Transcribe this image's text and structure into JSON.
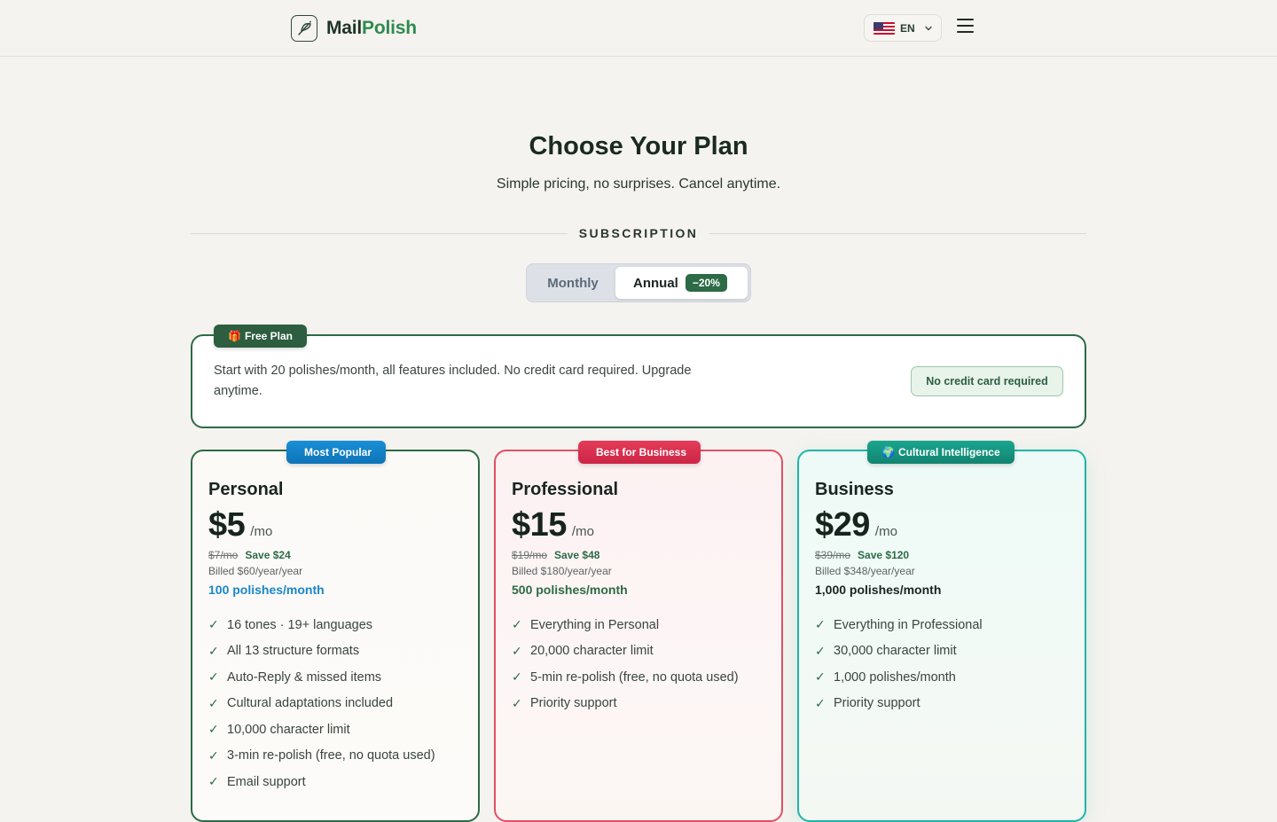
{
  "header": {
    "brand_part1": "Mail",
    "brand_part2": "Polish",
    "lang_code": "EN",
    "icons": {
      "logo": "quill-pen-icon",
      "flag": "us-flag-icon",
      "chevron": "chevron-down-icon",
      "menu": "hamburger-menu-icon"
    }
  },
  "hero": {
    "title": "Choose Your Plan",
    "subtitle": "Simple pricing, no surprises. Cancel anytime."
  },
  "section": {
    "label": "SUBSCRIPTION"
  },
  "billing_toggle": {
    "monthly": "Monthly",
    "annual": "Annual",
    "discount": "−20%",
    "selected": "Annual"
  },
  "free_plan": {
    "badge_icon": "🎁",
    "badge": "Free Plan",
    "description": "Start with 20 polishes/month, all features included. No credit card required. Upgrade anytime.",
    "pill": "No credit card required"
  },
  "plans": [
    {
      "badge_icon": "",
      "badge": "Most Popular",
      "name": "Personal",
      "price": "$5",
      "per": "/mo",
      "original": "$7/mo",
      "save": "Save $24",
      "billed": "Billed $60/year/year",
      "quota": "100 polishes/month",
      "features": [
        "16 tones · 19+ languages",
        "All 13 structure formats",
        "Auto-Reply & missed items",
        "Cultural adaptations included",
        "10,000 character limit",
        "3-min re-polish (free, no quota used)",
        "Email support"
      ]
    },
    {
      "badge_icon": "",
      "badge": "Best for Business",
      "name": "Professional",
      "price": "$15",
      "per": "/mo",
      "original": "$19/mo",
      "save": "Save $48",
      "billed": "Billed $180/year/year",
      "quota": "500 polishes/month",
      "features": [
        "Everything in Personal",
        "20,000 character limit",
        "5-min re-polish (free, no quota used)",
        "Priority support"
      ]
    },
    {
      "badge_icon": "🌍",
      "badge": "Cultural Intelligence",
      "name": "Business",
      "price": "$29",
      "per": "/mo",
      "original": "$39/mo",
      "save": "Save $120",
      "billed": "Billed $348/year/year",
      "quota": "1,000 polishes/month",
      "features": [
        "Everything in Professional",
        "30,000 character limit",
        "1,000 polishes/month",
        "Priority support"
      ]
    }
  ],
  "colors": {
    "background": "#f5f3ef",
    "brand_green": "#2c6b45",
    "personal_accent": "#1a86c8",
    "professional_accent": "#e05066",
    "business_accent": "#1fb5a8"
  }
}
